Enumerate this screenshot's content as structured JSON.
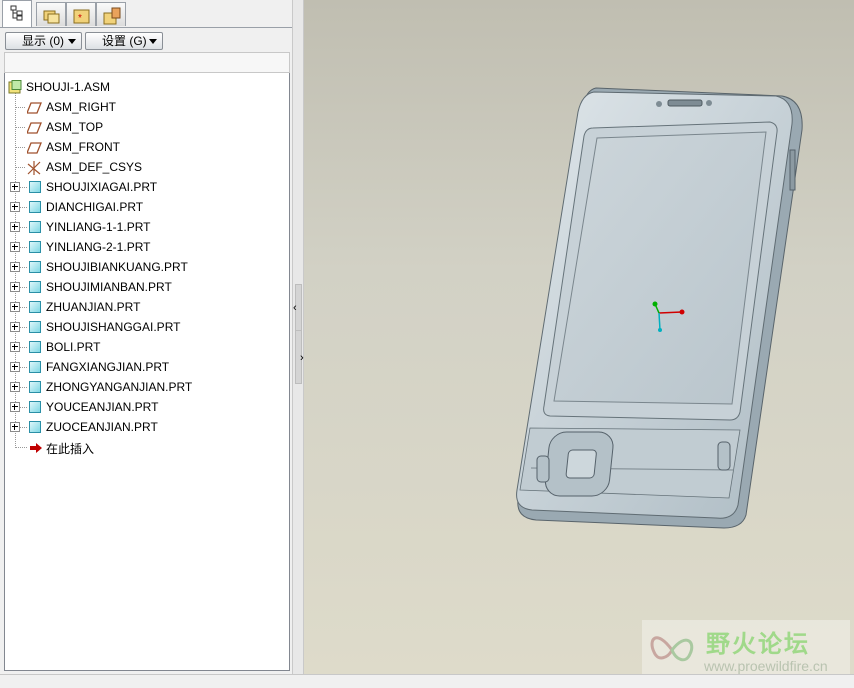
{
  "tabs": [
    {
      "icon": "model-tree-icon",
      "active": true
    },
    {
      "icon": "folder-browser-icon",
      "active": false
    },
    {
      "icon": "favorites-folder-icon",
      "active": false
    },
    {
      "icon": "connections-icon",
      "active": false
    }
  ],
  "toolbar": {
    "show_label": "显示 (0)",
    "settings_label": "设置 (G)"
  },
  "tree": {
    "root": "SHOUJI-1.ASM",
    "datums": [
      {
        "label": "ASM_RIGHT",
        "icon": "datum-plane-icon"
      },
      {
        "label": "ASM_TOP",
        "icon": "datum-plane-icon"
      },
      {
        "label": "ASM_FRONT",
        "icon": "datum-plane-icon"
      },
      {
        "label": "ASM_DEF_CSYS",
        "icon": "coordinate-system-icon"
      }
    ],
    "parts": [
      "SHOUJIXIAGAI.PRT",
      "DIANCHIGAI.PRT",
      "YINLIANG-1-1.PRT",
      "YINLIANG-2-1.PRT",
      "SHOUJIBIANKUANG.PRT",
      "SHOUJIMIANBAN.PRT",
      "ZHUANJIAN.PRT",
      "SHOUJISHANGGAI.PRT",
      "BOLI.PRT",
      "FANGXIANGJIAN.PRT",
      "ZHONGYANGANJIAN.PRT",
      "YOUCEANJIAN.PRT",
      "ZUOCEANJIAN.PRT"
    ],
    "insert_here": "在此插入"
  },
  "splitter": {
    "collapse_left": "‹",
    "expand_right": "›"
  },
  "watermark": {
    "title": "野火论坛",
    "url": "www.proewildfire.cn"
  },
  "colors": {
    "part_icon": "#7fd7e3",
    "datum_plane": "#a0522d",
    "insert_arrow": "#c00000",
    "csys_x": "#d00000",
    "csys_y": "#00b000",
    "csys_z": "#00b0c0"
  }
}
